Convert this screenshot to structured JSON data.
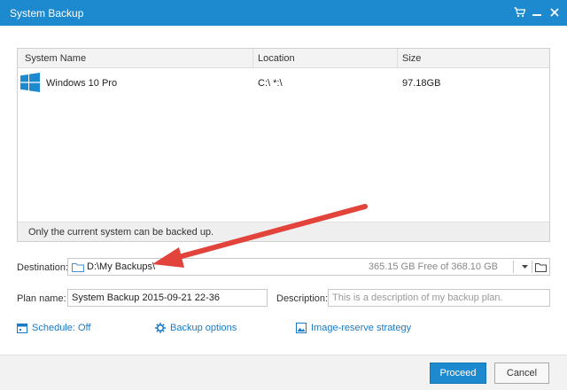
{
  "window": {
    "title": "System Backup",
    "icons": [
      "cart-icon",
      "minimize-icon",
      "close-icon"
    ]
  },
  "system_list": {
    "columns": [
      "System Name",
      "Location",
      "Size"
    ],
    "rows": [
      {
        "icon": "windows-logo-icon",
        "name": "Windows 10 Pro",
        "location": "C:\\ *:\\",
        "size": "97.18GB"
      }
    ],
    "footer_note": "Only the current system can be backed up."
  },
  "destination": {
    "label": "Destination:",
    "path": "D:\\My Backups\\",
    "free_space": "365.15 GB Free of 368.10 GB"
  },
  "plan": {
    "name_label": "Plan name:",
    "name_value": "System Backup 2015-09-21 22-36",
    "description_label": "Description:",
    "description_placeholder": "This is a description of my backup plan."
  },
  "options": {
    "schedule": "Schedule: Off",
    "backup_options": "Backup options",
    "image_reserve": "Image-reserve strategy"
  },
  "buttons": {
    "proceed": "Proceed",
    "cancel": "Cancel"
  },
  "colors": {
    "accent": "#1d8ad0",
    "annotation_arrow": "#e2433b",
    "link": "#1a7ac8"
  }
}
